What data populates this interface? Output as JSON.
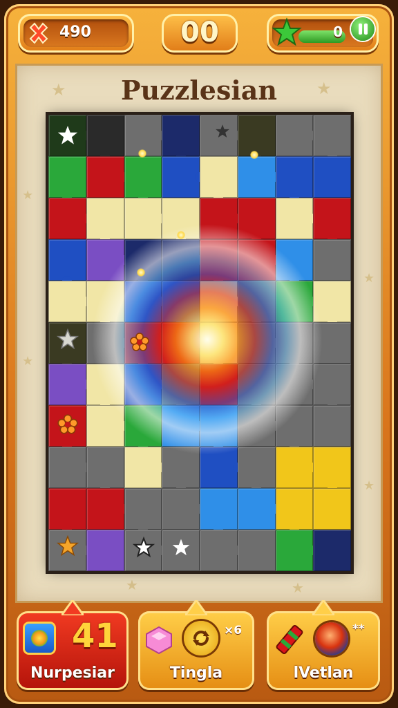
{
  "top_bar": {
    "moves": "490",
    "score": "00",
    "stars": "0"
  },
  "board": {
    "title": "Puzzlesian"
  },
  "powerups": [
    {
      "label": "Nurpesiar",
      "count": "41"
    },
    {
      "label": "Tingla",
      "multiplier": "×6"
    },
    {
      "label": "lVetlan",
      "multiplier": "**"
    }
  ],
  "colors": {
    "red": "#c4141a",
    "green": "#2aa83a",
    "blue": "#1f4fc2",
    "cream": "#f1e6a6",
    "gray": "#6e6e6e",
    "dark": "#2a2a2a",
    "yellow": "#f1c61a",
    "purple": "#7a4ec3",
    "sky": "#2f8fe8",
    "navy": "#1c2a6a",
    "darkgreen": "#1f3a1a",
    "olive": "#3a3a22"
  },
  "grid": {
    "cols": 8,
    "rows": 11,
    "cells": [
      [
        "darkgreen",
        "dark",
        "gray",
        "navy",
        "gray",
        "olive",
        "gray",
        "gray"
      ],
      [
        "green",
        "red",
        "green",
        "blue",
        "cream",
        "sky",
        "blue",
        "blue"
      ],
      [
        "red",
        "cream",
        "cream",
        "cream",
        "red",
        "red",
        "cream",
        "red"
      ],
      [
        "blue",
        "purple",
        "navy",
        "navy",
        "red",
        "red",
        "sky",
        "gray"
      ],
      [
        "cream",
        "cream",
        "blue",
        "blue",
        "cream",
        "gray",
        "green",
        "cream"
      ],
      [
        "olive",
        "gray",
        "red",
        "red",
        "cream",
        "gray",
        "gray",
        "gray"
      ],
      [
        "purple",
        "cream",
        "blue",
        "gray",
        "red",
        "gray",
        "gray",
        "gray"
      ],
      [
        "red",
        "cream",
        "green",
        "sky",
        "sky",
        "gray",
        "gray",
        "gray"
      ],
      [
        "gray",
        "gray",
        "cream",
        "gray",
        "blue",
        "gray",
        "yellow",
        "yellow"
      ],
      [
        "red",
        "red",
        "gray",
        "gray",
        "sky",
        "sky",
        "yellow",
        "yellow"
      ],
      [
        "gray",
        "purple",
        "gray",
        "gray",
        "gray",
        "gray",
        "green",
        "navy"
      ]
    ]
  }
}
